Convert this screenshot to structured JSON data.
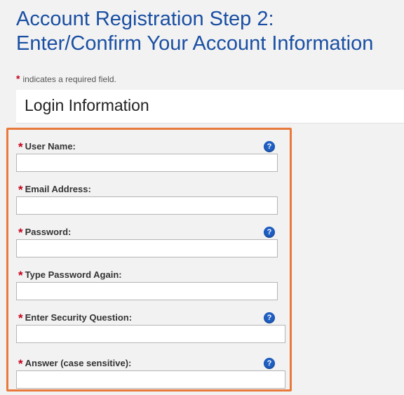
{
  "page": {
    "title_line1": "Account Registration Step 2:",
    "title_line2": "Enter/Confirm Your Account Information",
    "required_star": "*",
    "required_note": "indicates a required field."
  },
  "section": {
    "title": "Login Information"
  },
  "help_glyph": "?",
  "accent_colors": {
    "title": "#1a4fa3",
    "required": "#c4001a",
    "highlight_border": "#e8793a",
    "help_icon": "#1f5fc4"
  },
  "fields": [
    {
      "label": "User Name:",
      "value": "",
      "has_help": true
    },
    {
      "label": "Email Address:",
      "value": "",
      "has_help": false
    },
    {
      "label": "Password:",
      "value": "",
      "has_help": true
    },
    {
      "label": "Type Password Again:",
      "value": "",
      "has_help": false
    },
    {
      "label": "Enter Security Question:",
      "value": "",
      "has_help": true
    },
    {
      "label": "Answer (case sensitive):",
      "value": "",
      "has_help": true
    }
  ]
}
